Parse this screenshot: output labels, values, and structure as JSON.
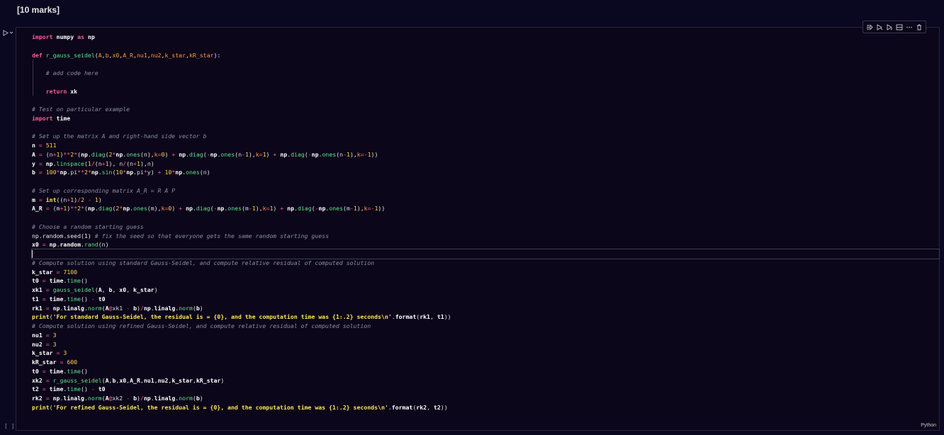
{
  "heading": "[10 marks]",
  "cell": {
    "language": "Python",
    "execution_count": "[ ]",
    "toolbar": [
      {
        "name": "run-by-line-icon"
      },
      {
        "name": "execute-above-icon"
      },
      {
        "name": "execute-below-icon"
      },
      {
        "name": "split-cell-icon"
      },
      {
        "name": "more-icon"
      },
      {
        "name": "delete-icon"
      }
    ],
    "code_lines": [
      "import numpy as np",
      "",
      "def r_gauss_seidel(A,b,x0,A_R,nu1,nu2,k_star,kR_star):",
      "",
      "    # add code here",
      "",
      "    return xk",
      "",
      "# Test on particular example",
      "import time",
      "",
      "# Set up the matrix A and right-hand side vector b",
      "n = 511",
      "A = (n+1)**2*(np.diag(2*np.ones(n),k=0) + np.diag(-np.ones(n-1),k=1) + np.diag(-np.ones(n-1),k=-1))",
      "y = np.linspace(1/(n+1), n/(n+1),n)",
      "b = 100*np.pi**2*np.sin(10*np.pi*y) + 10*np.ones(n)",
      "",
      "# Set up corresponding matrix A_R = R A P",
      "m = int((n+1)/2 - 1)",
      "A_R = (m+1)**2*(np.diag(2*np.ones(m),k=0) + np.diag(-np.ones(m-1),k=1) + np.diag(-np.ones(m-1),k=-1))",
      "",
      "# Choose a random starting guess",
      "np.random.seed(1) # fix the seed so that everyone gets the same random starting guess",
      "x0 = np.random.rand(n)",
      "",
      "# Compute solution using standard Gauss-Seidel, and compute relative residual of computed solution",
      "k_star = 7100",
      "t0 = time.time()",
      "xk1 = gauss_seidel(A, b, x0, k_star)",
      "t1 = time.time() - t0",
      "rk1 = np.linalg.norm(A@xk1 - b)/np.linalg.norm(b)",
      "print('For standard Gauss-Seidel, the residual is = {0}, and the computation time was {1:.2} seconds\\n'.format(rk1, t1))",
      "# Compute solution using refined Gauss-Seidel, and compute relative residual of computed solution",
      "nu1 = 3",
      "nu2 = 3",
      "k_star = 3",
      "kR_star = 600",
      "t0 = time.time()",
      "xk2 = r_gauss_seidel(A,b,x0,A_R,nu1,nu2,k_star,kR_star)",
      "t2 = time.time() - t0",
      "rk2 = np.linalg.norm(A@xk2 - b)/np.linalg.norm(b)",
      "print('For refined Gauss-Seidel, the residual is = {0}, and the computation time was {1:.2} seconds\\n'.format(rk2, t2))"
    ],
    "active_line": 24
  },
  "colors": {
    "background": "#0a0720",
    "keyword": "#ff5b9d",
    "function": "#5fe28a",
    "parameter": "#ff9a3c",
    "number": "#ffd14a",
    "string": "#ffe45a",
    "comment": "#8b8fa5"
  }
}
